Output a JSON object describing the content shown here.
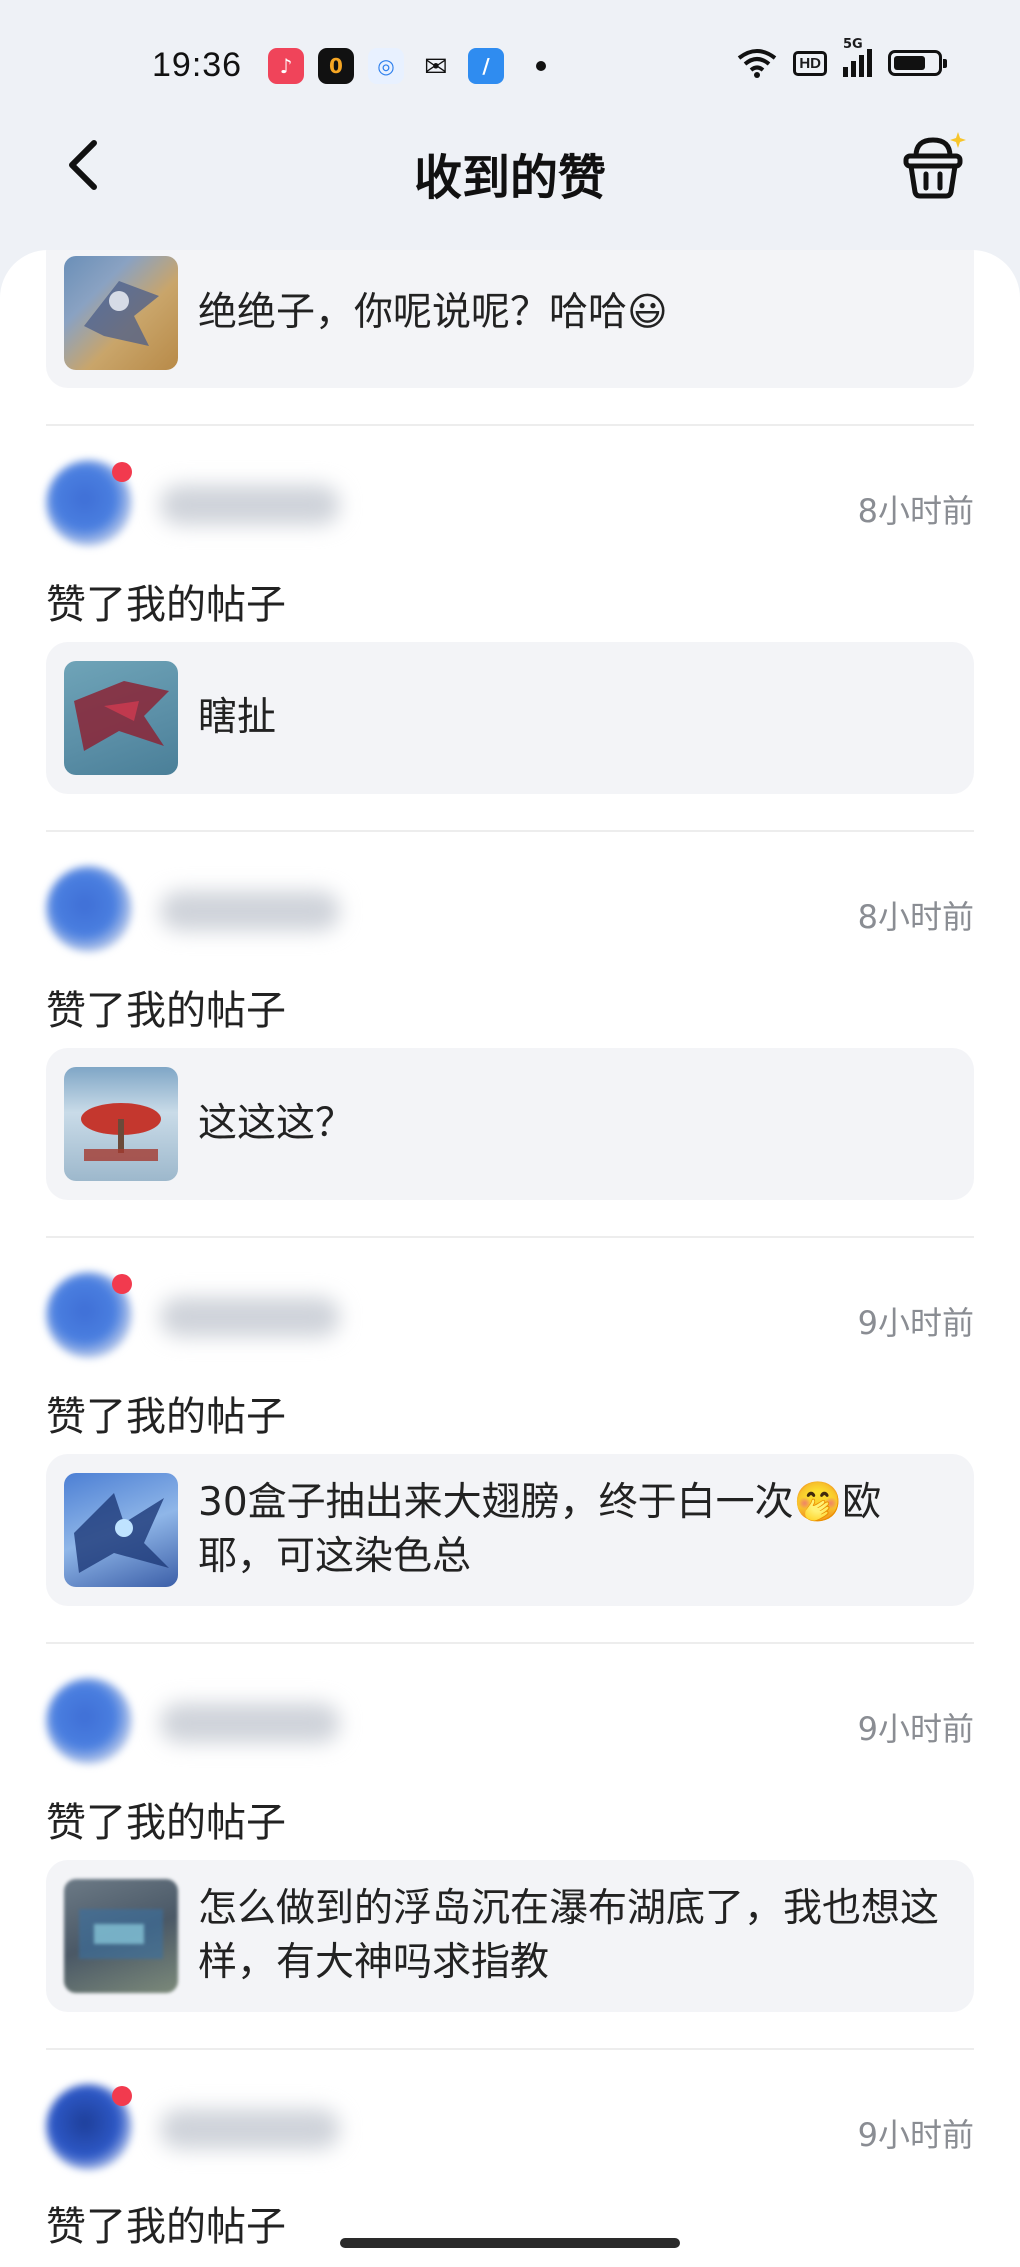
{
  "status_bar": {
    "time": "19:36",
    "app_icons": [
      "music-app-icon",
      "o-app-icon",
      "browser-icon",
      "wechat-icon",
      "feather-app-icon"
    ],
    "hd_label": "HD",
    "network_label": "5G"
  },
  "header": {
    "title": "收到的赞"
  },
  "first_card": {
    "text": "绝绝子，你呢说呢？哈哈😃"
  },
  "notifications": [
    {
      "time": "8小时前",
      "action": "赞了我的帖子",
      "post_text": "瞎扯"
    },
    {
      "time": "8小时前",
      "action": "赞了我的帖子",
      "post_text": "这这这？"
    },
    {
      "time": "9小时前",
      "action": "赞了我的帖子",
      "post_text": "30盒子抽出来大翅膀，终于白一次🤭欧耶，可这染色总"
    },
    {
      "time": "9小时前",
      "action": "赞了我的帖子",
      "post_text": "怎么做到的浮岛沉在瀑布湖底了，我也想这样，有大神吗求指教"
    },
    {
      "time": "9小时前",
      "action": "赞了我的帖子"
    }
  ],
  "colors": {
    "background": "#eef1f6",
    "card": "#f3f4f7",
    "badge": "#f23a4e",
    "time_text": "#8a8d93"
  }
}
